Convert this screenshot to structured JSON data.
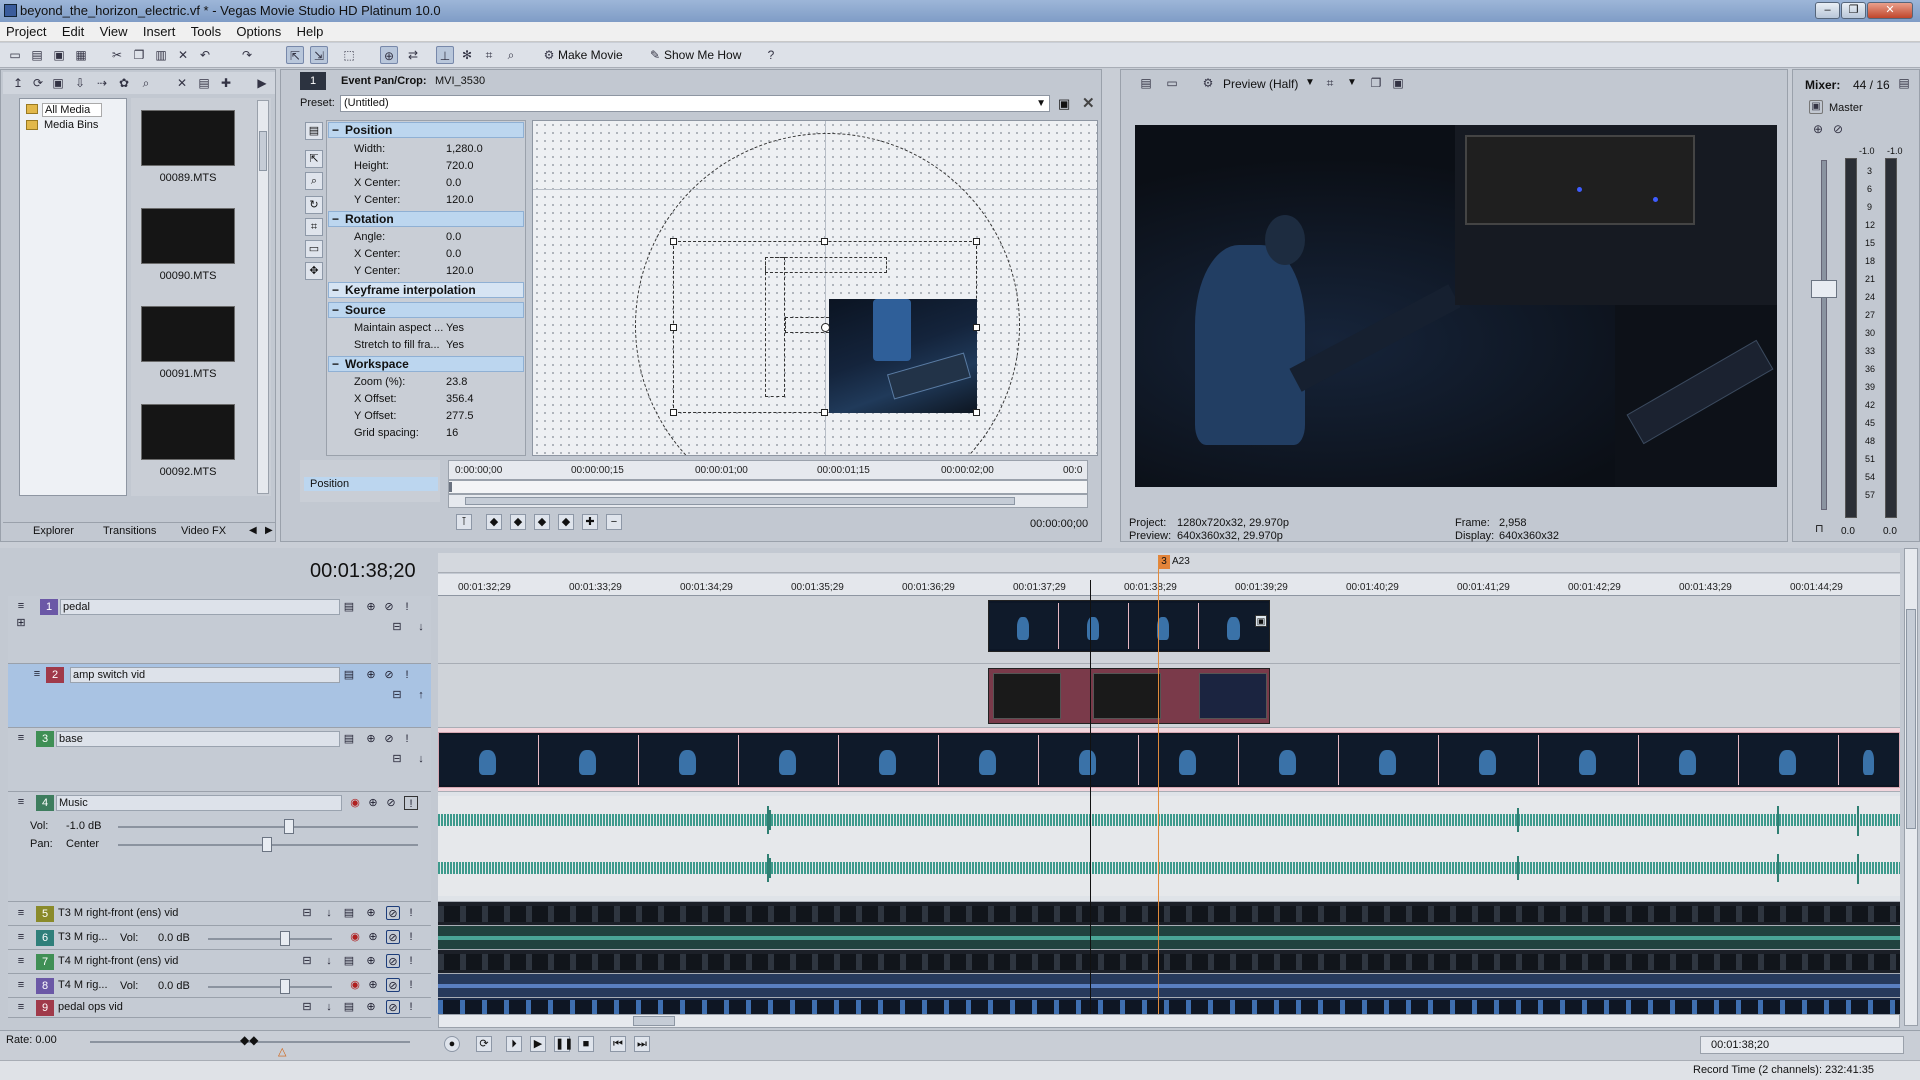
{
  "window": {
    "title": "beyond_the_horizon_electric.vf * - Vegas Movie Studio HD Platinum 10.0",
    "controls": [
      "–",
      "❐",
      "✕"
    ]
  },
  "menu": [
    "Project",
    "Edit",
    "View",
    "Insert",
    "Tools",
    "Options",
    "Help"
  ],
  "toolbar": {
    "make_movie": "Make Movie",
    "show_me_how": "Show Me How"
  },
  "explorer": {
    "tree": [
      "All Media",
      "Media Bins"
    ],
    "thumbs": [
      "00089.MTS",
      "00090.MTS",
      "00091.MTS",
      "00092.MTS"
    ],
    "tabs": [
      "Explorer",
      "Transitions",
      "Video FX"
    ]
  },
  "panCrop": {
    "number": "1",
    "title": "Event Pan/Crop:",
    "clip": "MVI_3530",
    "preset_label": "Preset:",
    "preset_value": "(Untitled)",
    "sections": {
      "position": "Position",
      "rotation": "Rotation",
      "keyframe": "Keyframe interpolation",
      "source": "Source",
      "workspace": "Workspace"
    },
    "position": {
      "width_k": "Width:",
      "width_v": "1,280.0",
      "height_k": "Height:",
      "height_v": "720.0",
      "xc_k": "X Center:",
      "xc_v": "0.0",
      "yc_k": "Y Center:",
      "yc_v": "120.0"
    },
    "rotation": {
      "angle_k": "Angle:",
      "angle_v": "0.0",
      "xc_k": "X Center:",
      "xc_v": "0.0",
      "yc_k": "Y Center:",
      "yc_v": "120.0"
    },
    "source": {
      "aspect_k": "Maintain aspect ...",
      "aspect_v": "Yes",
      "stretch_k": "Stretch to fill fra...",
      "stretch_v": "Yes"
    },
    "workspace": {
      "zoom_k": "Zoom (%):",
      "zoom_v": "23.8",
      "xo_k": "X Offset:",
      "xo_v": "356.4",
      "yo_k": "Y Offset:",
      "yo_v": "277.5",
      "grid_k": "Grid spacing:",
      "grid_v": "16"
    },
    "keyframe_ruler": [
      "0:00:00;00",
      "00:00:00;15",
      "00:00:01;00",
      "00:00:01;15",
      "00:00:02;00",
      "00:0"
    ],
    "position_track": "Position",
    "timecode": "00:00:00;00"
  },
  "preview": {
    "mode": "Preview (Half)",
    "project_label": "Project:",
    "project_value": "1280x720x32, 29.970p",
    "preview_label": "Preview:",
    "preview_value": "640x360x32, 29.970p",
    "frame_label": "Frame:",
    "frame_value": "2,958",
    "display_label": "Display:",
    "display_value": "640x360x32"
  },
  "mixer": {
    "title": "Mixer:",
    "value": "44 / 16",
    "master": "Master",
    "scale": [
      "-1.0",
      "-1.0",
      "3",
      "6",
      "9",
      "12",
      "15",
      "18",
      "21",
      "24",
      "27",
      "30",
      "33",
      "36",
      "39",
      "42",
      "45",
      "48",
      "51",
      "54",
      "57"
    ],
    "bottom": [
      "0.0",
      "0.0"
    ]
  },
  "timeline": {
    "timecode": "00:01:38;20",
    "marker": "3",
    "marker_label": "A23",
    "ruler": [
      "00:01:32;29",
      "00:01:33;29",
      "00:01:34;29",
      "00:01:35;29",
      "00:01:36;29",
      "00:01:37;29",
      "00:01:38;29",
      "00:01:39;29",
      "00:01:40;29",
      "00:01:41;29",
      "00:01:42;29",
      "00:01:43;29",
      "00:01:44;29"
    ],
    "tracks": [
      {
        "num": "1",
        "name": "pedal",
        "color": "#6b58a6"
      },
      {
        "num": "2",
        "name": "amp switch vid",
        "color": "#a03a4a"
      },
      {
        "num": "3",
        "name": "base",
        "color": "#3f8f55"
      },
      {
        "num": "4",
        "name": "Music",
        "color": "#3e7d5e"
      },
      {
        "num": "5",
        "name": "T3 M right-front (ens) vid",
        "color": "#8a8a2a"
      },
      {
        "num": "6",
        "name": "T3 M rig...",
        "color": "#2f7f7a"
      },
      {
        "num": "7",
        "name": "T4 M right-front (ens) vid",
        "color": "#3f8f55"
      },
      {
        "num": "8",
        "name": "T4 M rig...",
        "color": "#6b58a6"
      },
      {
        "num": "9",
        "name": "pedal ops vid",
        "color": "#a03a4a"
      }
    ],
    "music": {
      "vol_label": "Vol:",
      "vol_value": "-1.0 dB",
      "pan_label": "Pan:",
      "pan_value": "Center"
    },
    "track6": {
      "vol_label": "Vol:",
      "vol_value": "0.0 dB"
    },
    "track8": {
      "vol_label": "Vol:",
      "vol_value": "0.0 dB"
    },
    "rate": "Rate: 0.00",
    "transport_time": "00:01:38;20",
    "status": "Record Time (2 channels): 232:41:35"
  }
}
